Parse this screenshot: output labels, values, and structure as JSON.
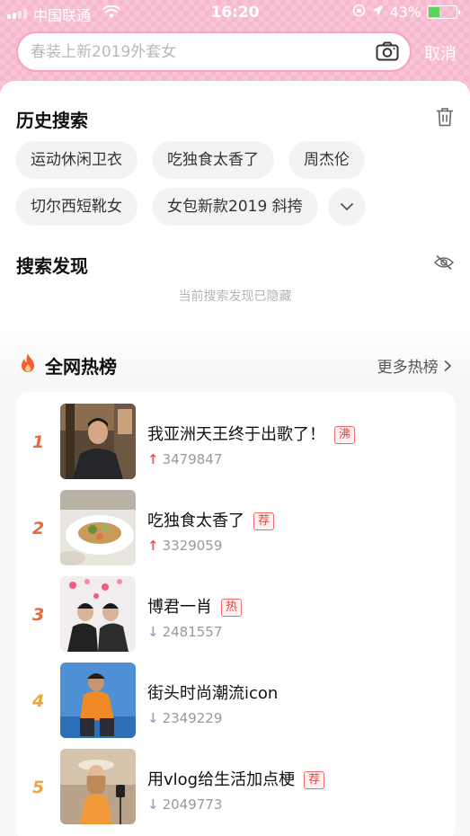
{
  "status_bar": {
    "carrier": "中国联通",
    "time": "16:20",
    "battery": "43%",
    "battery_level": 0.43
  },
  "search": {
    "placeholder": "春装上新2019外套女",
    "cancel_label": "取消"
  },
  "history": {
    "title": "历史搜索",
    "chips": [
      "运动休闲卫衣",
      "吃独食太香了",
      "周杰伦",
      "切尔西短靴女",
      "女包新款2019 斜挎"
    ]
  },
  "discover": {
    "title": "搜索发现",
    "hidden_tip": "当前搜索发现已隐藏"
  },
  "hot": {
    "title": "全网热榜",
    "more_label": "更多热榜",
    "items": [
      {
        "rank": "1",
        "title": "我亚洲天王终于出歌了！",
        "badge": "沸",
        "count": "3479847",
        "trend": "up"
      },
      {
        "rank": "2",
        "title": "吃独食太香了",
        "badge": "荐",
        "count": "3329059",
        "trend": "up"
      },
      {
        "rank": "3",
        "title": "博君一肖",
        "badge": "热",
        "count": "2481557",
        "trend": "down"
      },
      {
        "rank": "4",
        "title": "街头时尚潮流icon",
        "badge": "",
        "count": "2349229",
        "trend": "down"
      },
      {
        "rank": "5",
        "title": "用vlog给生活加点梗",
        "badge": "荐",
        "count": "2049773",
        "trend": "down"
      }
    ]
  },
  "colors": {
    "header_pink": "#f7b8cf",
    "rank_1_2_3": "#e8693c",
    "rank_4_5": "#f0a53a",
    "badge_red": "#e84040"
  }
}
